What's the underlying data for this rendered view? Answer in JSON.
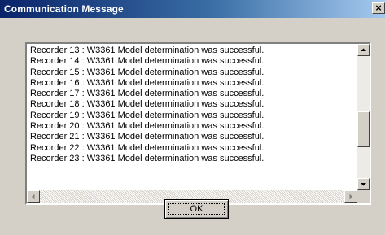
{
  "window": {
    "title": "Communication Message",
    "close_glyph": "×"
  },
  "messages": [
    "Recorder 13 : W3361 Model determination was successful.",
    "Recorder 14 : W3361 Model determination was successful.",
    "Recorder 15 : W3361 Model determination was successful.",
    "Recorder 16 : W3361 Model determination was successful.",
    "Recorder 17 : W3361 Model determination was successful.",
    "Recorder 18 : W3361 Model determination was successful.",
    "Recorder 19 : W3361 Model determination was successful.",
    "Recorder 20 : W3361 Model determination was successful.",
    "Recorder 21 : W3361 Model determination was successful.",
    "Recorder 22 : W3361 Model determination was successful.",
    "Recorder 23 : W3361 Model determination was successful."
  ],
  "buttons": {
    "ok_label": "OK"
  },
  "colors": {
    "titlebar_start": "#0a246a",
    "titlebar_end": "#a6caf0",
    "face": "#d4d0c8"
  }
}
